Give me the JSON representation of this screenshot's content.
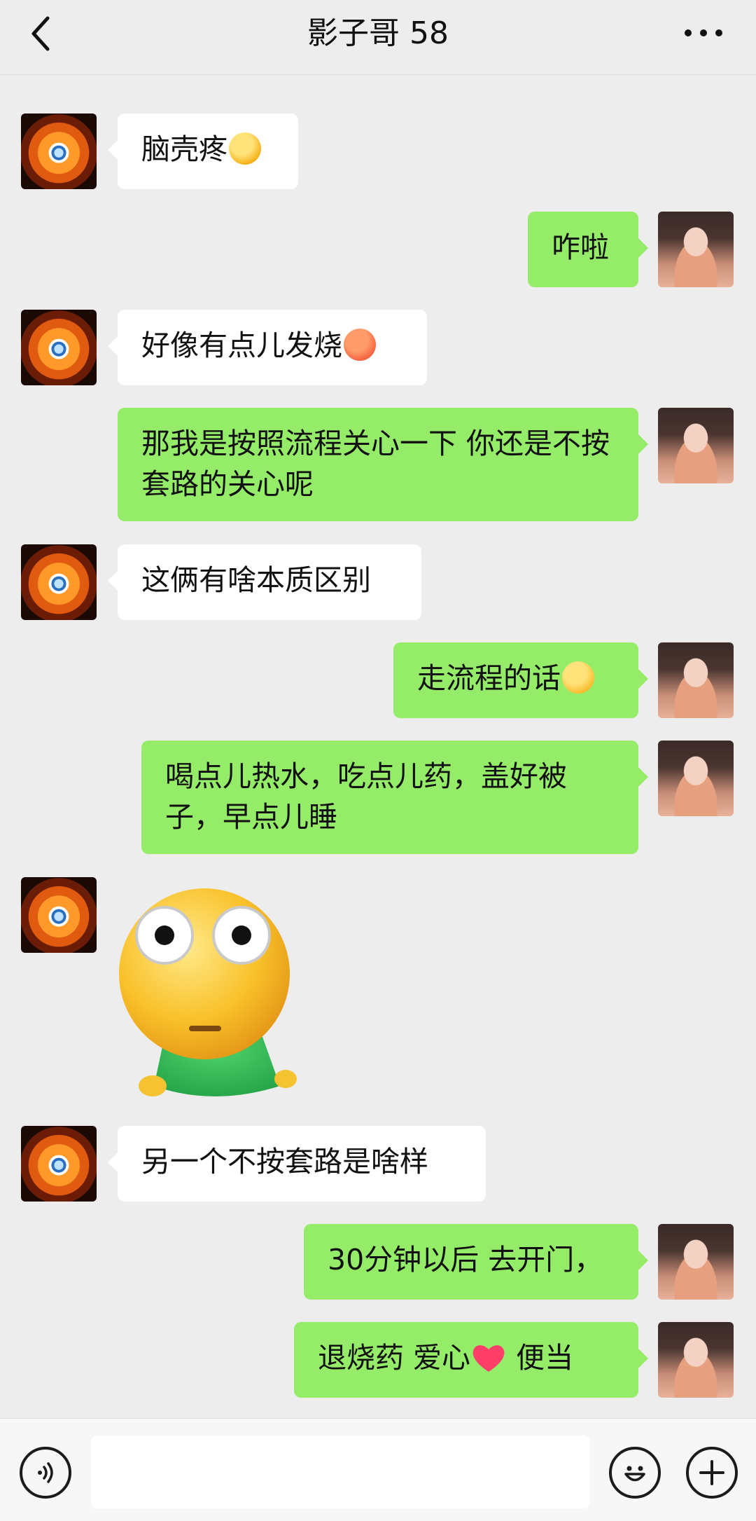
{
  "header": {
    "title": "影子哥 58"
  },
  "messages": [
    {
      "side": "left",
      "text": "脑壳疼",
      "emoji": "cry-emoji"
    },
    {
      "side": "right",
      "text": "咋啦"
    },
    {
      "side": "left",
      "text": "好像有点儿发烧",
      "emoji": "hot-face-emoji"
    },
    {
      "side": "right",
      "text": "那我是按照流程关心一下  你还是不按套路的关心呢"
    },
    {
      "side": "left",
      "text": "这俩有啥本质区别"
    },
    {
      "side": "right",
      "text": "走流程的话",
      "emoji": "eye-roll-emoji"
    },
    {
      "side": "right",
      "text": "喝点儿热水，吃点儿药，盖好被子，早点儿睡"
    },
    {
      "side": "left",
      "sticker": "wide-eyed-face-sticker"
    },
    {
      "side": "left",
      "text": "另一个不按套路是啥样"
    },
    {
      "side": "right",
      "text": "30分钟以后 去开门，"
    },
    {
      "side": "right",
      "text_before": "退烧药 爱心",
      "emoji": "heart-emoji",
      "text_after": " 便当"
    }
  ],
  "input": {
    "placeholder": ""
  },
  "icons": {
    "back": "chevron-left-icon",
    "more": "more-dots-icon",
    "voice": "voice-icon",
    "emoji": "emoji-icon",
    "plus": "plus-icon"
  },
  "colors": {
    "background": "#ededed",
    "sent_bubble": "#95ec69",
    "received_bubble": "#ffffff"
  }
}
